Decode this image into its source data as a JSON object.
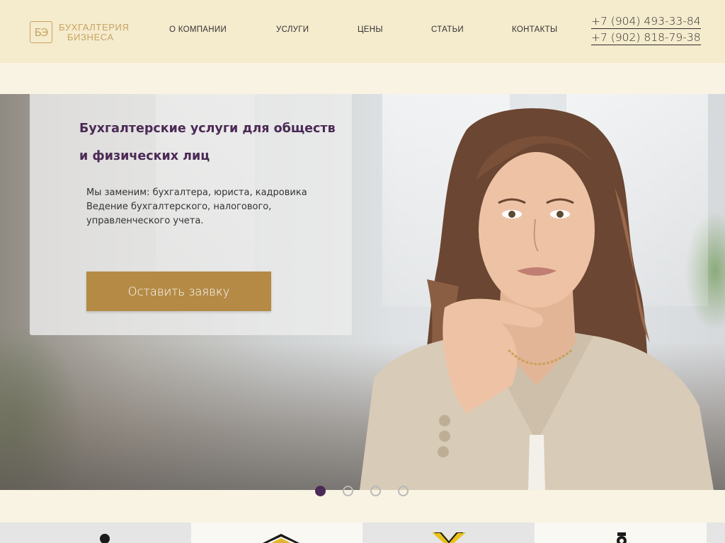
{
  "header": {
    "logo": {
      "mark": "БЭ",
      "line1": "БУХГАЛТЕРИЯ",
      "line2": "БИЗНЕСА"
    },
    "nav": [
      {
        "label": "О КОМПАНИИ"
      },
      {
        "label": "УСЛУГИ"
      },
      {
        "label": "ЦЕНЫ"
      },
      {
        "label": "СТАТЬИ"
      },
      {
        "label": "КОНТАКТЫ"
      }
    ],
    "phones": [
      "+7 (904) 493-33-84",
      "+7 (902) 818-79-38"
    ]
  },
  "hero": {
    "title_line1": "Бухгалтерские услуги для обществ",
    "title_line2": "и физических лиц",
    "desc_line1": "Мы заменим: бухгалтера, юриста, кадровика",
    "desc_line2": "Ведение бухгалтерского, налогового,",
    "desc_line3": "управленческого учета.",
    "cta_label": "Оставить заявку"
  },
  "slider": {
    "count": 4,
    "active_index": 1
  },
  "tiles": [
    {
      "icon": "person-icon"
    },
    {
      "icon": "crown-icon"
    },
    {
      "icon": "scales-icon"
    },
    {
      "icon": "gears-icon"
    }
  ],
  "colors": {
    "accent": "#b48a45",
    "brand": "#4b2a55",
    "header_bg": "#f5ebcd",
    "page_bg": "#f8f3e2",
    "logo": "#c7a463"
  }
}
